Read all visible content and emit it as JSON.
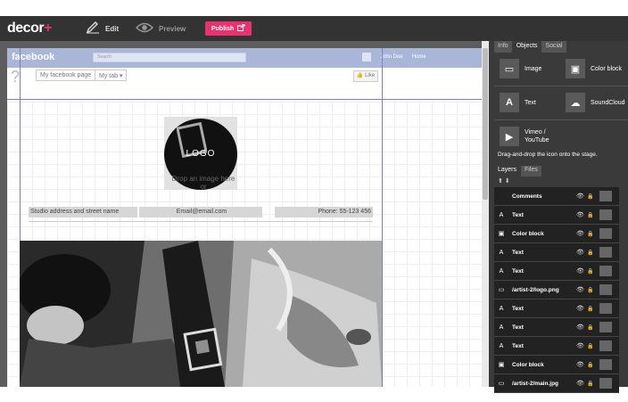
{
  "toolbar": {
    "logo_main": "decor",
    "logo_plus": "+",
    "edit_label": "Edit",
    "preview_label": "Preview",
    "publish_label": "Publish"
  },
  "facebook": {
    "logo": "facebook",
    "search_placeholder": "Search",
    "user_name": "John Doe",
    "home_label": "Home",
    "page_tab": "My facebook page",
    "my_tab": "My tab",
    "like_label": "Like"
  },
  "stage": {
    "logo_text": "LOGO",
    "drop_text_1": "Drop an image here",
    "drop_text_2": "or",
    "address": "Studio address and street name",
    "email": "Email@email.com",
    "phone": "Phone: 55-123 456"
  },
  "side": {
    "tabs": [
      "Info",
      "Objects",
      "Social"
    ],
    "objects": [
      {
        "label": "Image",
        "icon": "image-icon"
      },
      {
        "label": "Color block",
        "icon": "color-block-icon"
      },
      {
        "label": "Text",
        "icon": "text-icon"
      },
      {
        "label": "SoundCloud",
        "icon": "soundcloud-icon"
      },
      {
        "label": "Vimeo / YouTube",
        "icon": "video-icon"
      }
    ],
    "hint": "Drag-and-drop the icon onto the stage.",
    "layer_tabs": [
      "Layers",
      "Files"
    ],
    "layers": [
      {
        "name": "Comments",
        "icon": "comments-icon"
      },
      {
        "name": "Text",
        "icon": "text-icon"
      },
      {
        "name": "Color block",
        "icon": "color-block-icon"
      },
      {
        "name": "Text",
        "icon": "text-icon"
      },
      {
        "name": "Text",
        "icon": "text-icon"
      },
      {
        "name": "/artist-2/logo.png",
        "icon": "image-icon"
      },
      {
        "name": "Text",
        "icon": "text-icon"
      },
      {
        "name": "Text",
        "icon": "text-icon"
      },
      {
        "name": "Text",
        "icon": "text-icon"
      },
      {
        "name": "Color block",
        "icon": "color-block-icon"
      },
      {
        "name": "/artist-2/main.jpg",
        "icon": "image-icon"
      }
    ]
  }
}
